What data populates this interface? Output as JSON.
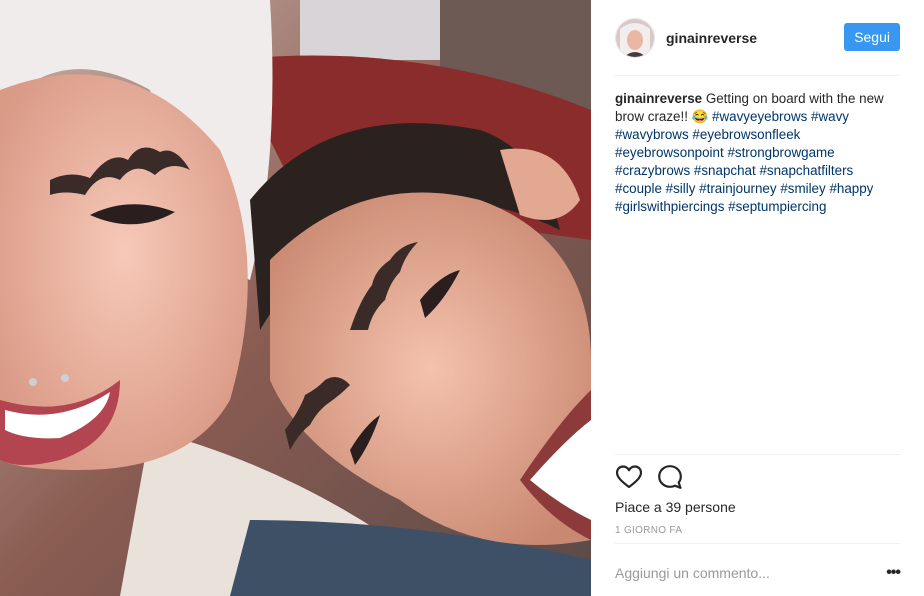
{
  "post": {
    "username": "ginainreverse",
    "follow_label": "Segui",
    "caption": {
      "username": "ginainreverse",
      "text": " Getting on board with the new brow craze!! 😂 ",
      "hashtags": [
        "#wavyeyebrows",
        "#wavy",
        "#wavybrows",
        "#eyebrowsonfleek",
        "#eyebrowsonpoint",
        "#strongbrowgame",
        "#crazybrows",
        "#snapchat",
        "#snapchatfilters",
        "#couple",
        "#silly",
        "#trainjourney",
        "#smiley",
        "#happy",
        "#girlswithpiercings",
        "#septumpiercing"
      ]
    },
    "likes_text": "Piace a 39 persone",
    "timestamp": "1 GIORNO FA",
    "comment_placeholder": "Aggiungi un commento...",
    "more_label": "•••",
    "icons": {
      "like": "heart-icon",
      "comment": "comment-bubble-icon",
      "more": "more-options-icon"
    },
    "colors": {
      "follow_button": "#3897f0",
      "hashtag": "#003569",
      "muted": "#999999"
    }
  }
}
